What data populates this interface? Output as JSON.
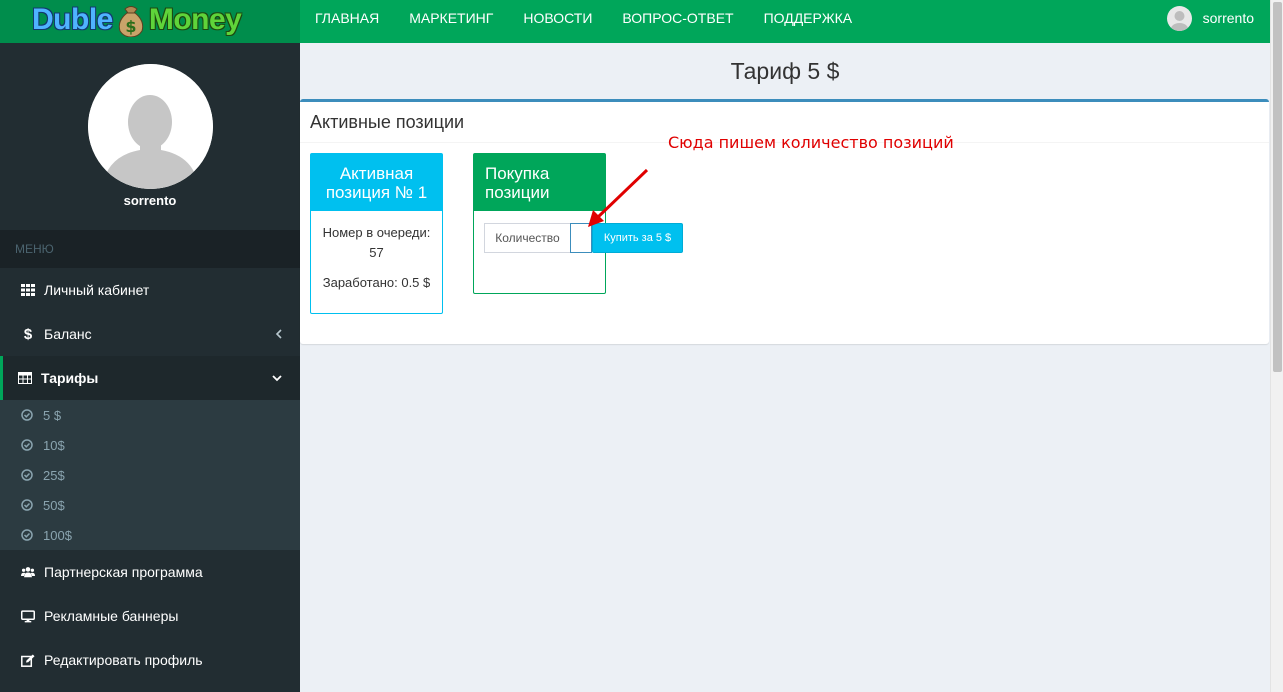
{
  "header": {
    "logo_part1": "Duble",
    "logo_part2": "Money",
    "nav": [
      "ГЛАВНАЯ",
      "МАРКЕТИНГ",
      "НОВОСТИ",
      "ВОПРОС-ОТВЕТ",
      "ПОДДЕРЖКА"
    ],
    "username": "sorrento"
  },
  "sidebar": {
    "username": "sorrento",
    "menu_header": "МЕНЮ",
    "items": [
      {
        "label": "Личный кабинет",
        "icon": "grid-icon"
      },
      {
        "label": "Баланс",
        "icon": "dollar-icon"
      },
      {
        "label": "Тарифы",
        "icon": "table-icon"
      },
      {
        "label": "Партнерская программа",
        "icon": "users-icon"
      },
      {
        "label": "Рекламные баннеры",
        "icon": "monitor-icon"
      },
      {
        "label": "Редактировать профиль",
        "icon": "edit-icon"
      }
    ],
    "tariffs": [
      "5 $",
      "10$",
      "25$",
      "50$",
      "100$"
    ]
  },
  "page": {
    "title": "Тариф 5 $"
  },
  "box": {
    "title": "Активные позиции",
    "active_card": {
      "title": "Активная позиция № 1",
      "queue_label": "Номер в очереди: 57",
      "earned_label": "Заработано: 0.5 $"
    },
    "buy_card": {
      "title": "Покупка позиции",
      "qty_label": "Количество",
      "qty_value": "",
      "buy_button": "Купить за 5 $"
    }
  },
  "annotation": "Сюда пишем количество позиций",
  "colors": {
    "header_green": "#00a65a",
    "sidebar_dark": "#222d32",
    "info_blue": "#00c0ef",
    "annotation_red": "#e00000"
  }
}
